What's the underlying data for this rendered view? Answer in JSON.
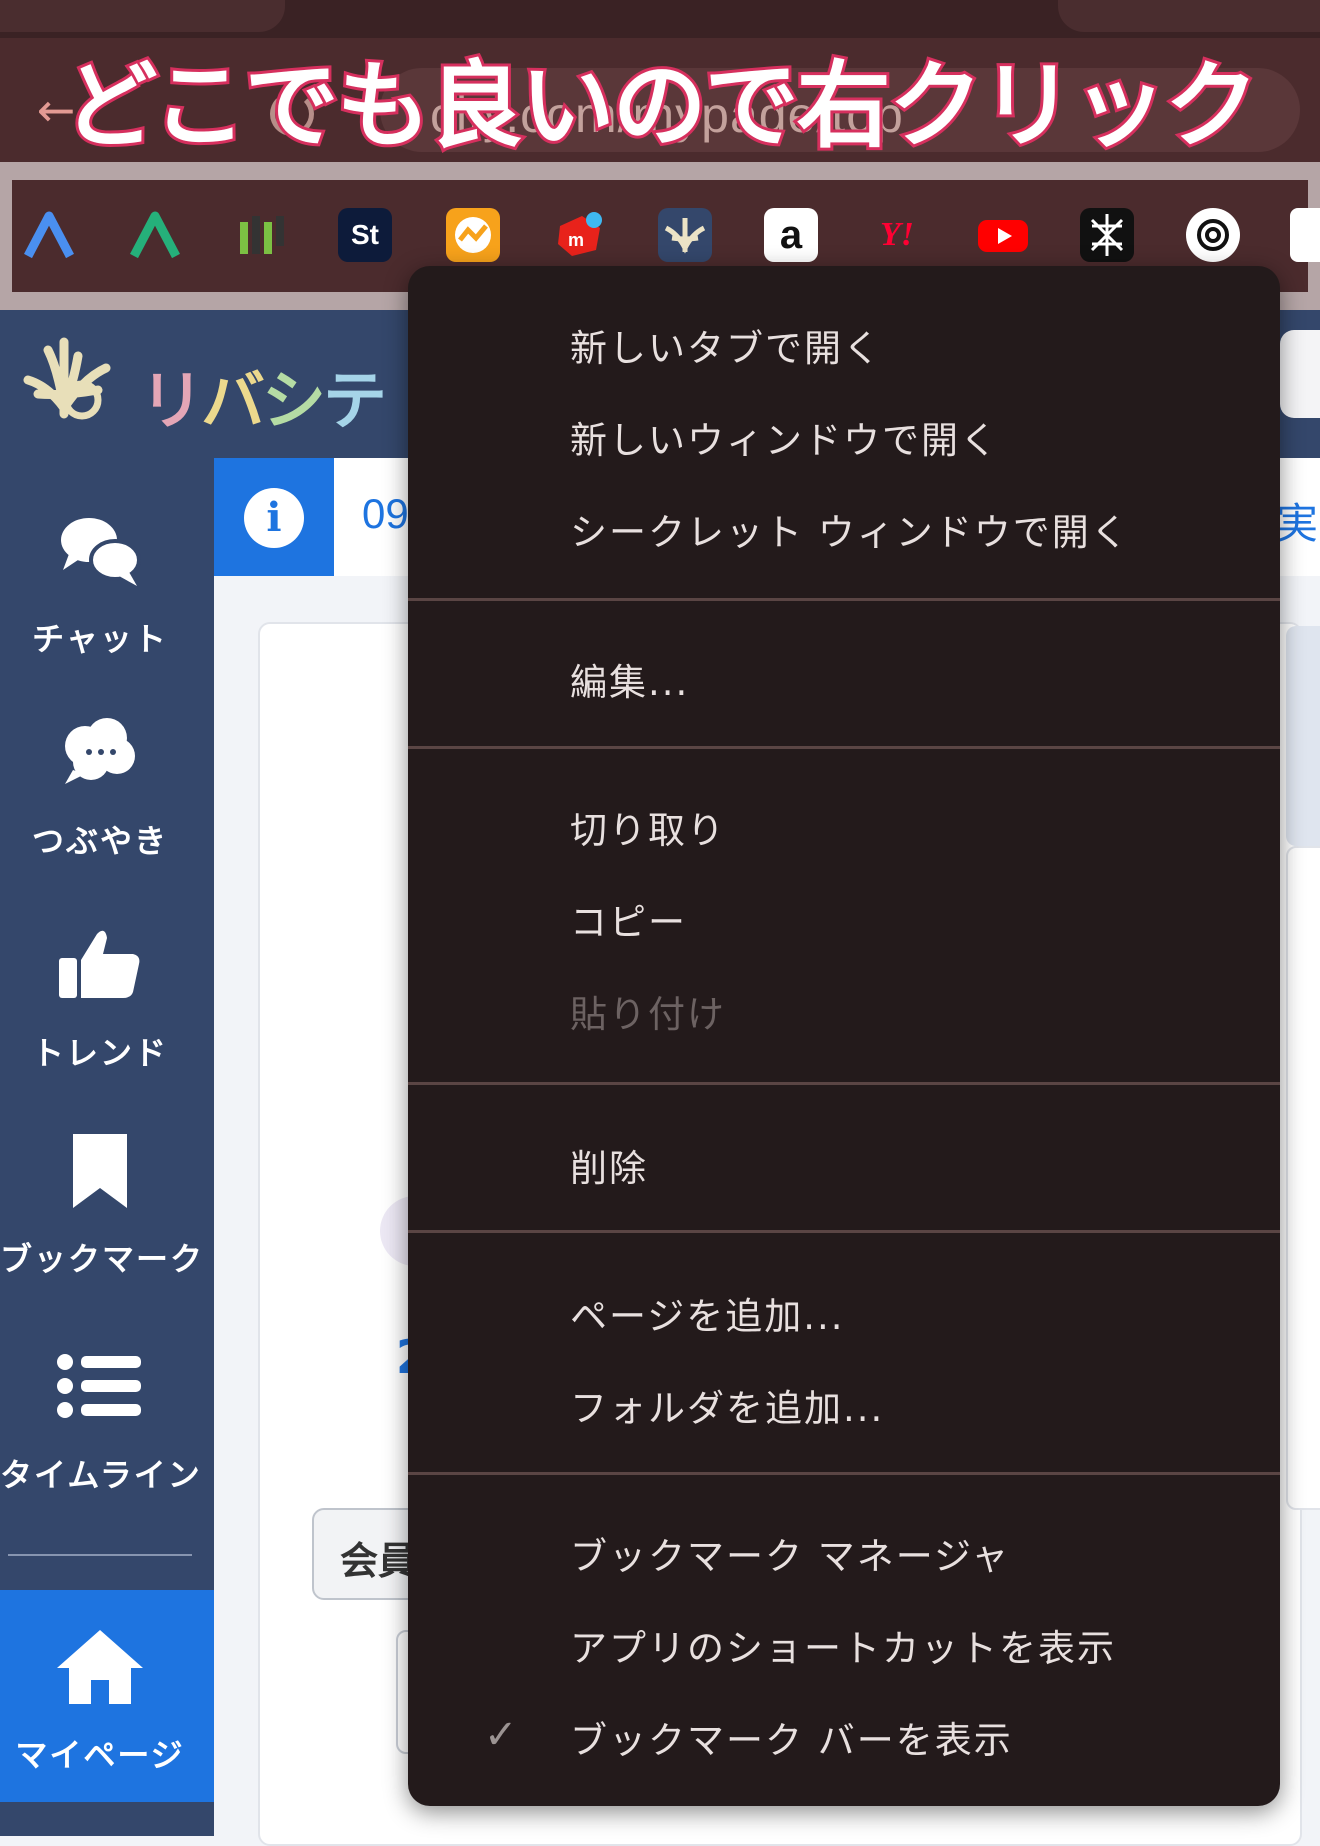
{
  "overlay": {
    "caption": "どこでも良いので右クリック"
  },
  "browser": {
    "back_icon": "arrow-left-icon",
    "url": "city.com/mypage/top"
  },
  "bookmarks": [
    {
      "name": "liberty-a-blue"
    },
    {
      "name": "liberty-a-green"
    },
    {
      "name": "mf-logo"
    },
    {
      "name": "st-logo",
      "label": "St"
    },
    {
      "name": "chart-logo"
    },
    {
      "name": "mercari-logo",
      "label": "m"
    },
    {
      "name": "libecity-logo"
    },
    {
      "name": "amazon-logo",
      "label": "a"
    },
    {
      "name": "yahoo-logo",
      "label": "Y!"
    },
    {
      "name": "youtube-logo"
    },
    {
      "name": "perplexity-logo"
    },
    {
      "name": "chatgpt-logo"
    },
    {
      "name": "notion-logo"
    }
  ],
  "site": {
    "logo_text": [
      "リ",
      "バ",
      "シ",
      "テ"
    ],
    "info_text": "09",
    "info_right": "実",
    "card_button": "会員",
    "card_num": "2"
  },
  "sidebar": {
    "items": [
      {
        "label": "チャット",
        "icon": "chat-bubbles-icon"
      },
      {
        "label": "つぶやき",
        "icon": "speech-cloud-icon"
      },
      {
        "label": "トレンド",
        "icon": "thumbs-up-icon"
      },
      {
        "label": "ブックマーク",
        "icon": "bookmark-icon"
      },
      {
        "label": "タイムライン",
        "icon": "list-icon"
      },
      {
        "label": "マイページ",
        "icon": "home-icon"
      }
    ]
  },
  "context_menu": {
    "groups": [
      [
        "新しいタブで開く",
        "新しいウィンドウで開く",
        "シークレット ウィンドウで開く"
      ],
      [
        "編集..."
      ],
      [
        "切り取り",
        "コピー",
        "貼り付け"
      ],
      [
        "削除"
      ],
      [
        "ページを追加...",
        "フォルダを追加..."
      ],
      [
        "ブックマーク マネージャ",
        "アプリのショートカットを表示",
        "ブックマーク バーを表示"
      ]
    ],
    "disabled": [
      "貼り付け"
    ],
    "checked": [
      "ブックマーク バーを表示"
    ],
    "check_mark": "✓"
  },
  "colors": {
    "menu_bg": "#231a1b",
    "sidebar_bg": "#34476b",
    "accent_blue": "#1e74e0",
    "caption_stroke": "#d6305e"
  }
}
